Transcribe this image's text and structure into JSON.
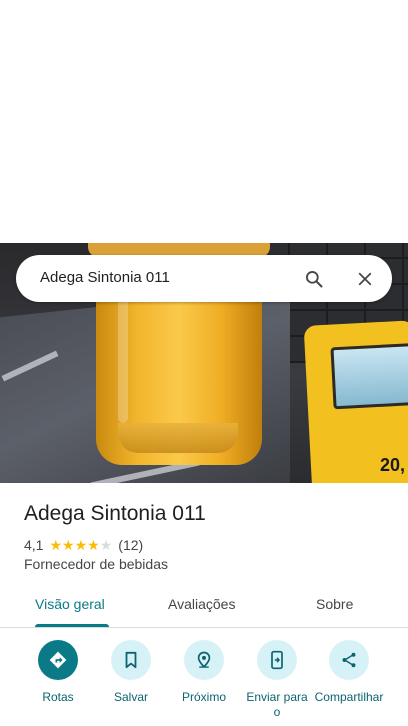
{
  "search": {
    "query": "Adega Sintonia 011"
  },
  "photo": {
    "machine_text": "20,"
  },
  "place": {
    "name": "Adega Sintonia 011",
    "rating": "4,1",
    "rating_value": 4.1,
    "rating_max": 5,
    "review_count": "(12)",
    "category": "Fornecedor de bebidas"
  },
  "tabs": [
    {
      "label": "Visão geral",
      "active": true
    },
    {
      "label": "Avaliações",
      "active": false
    },
    {
      "label": "Sobre",
      "active": false
    }
  ],
  "actions": [
    {
      "label": "Rotas",
      "icon": "directions-icon"
    },
    {
      "label": "Salvar",
      "icon": "bookmark-icon"
    },
    {
      "label": "Próximo",
      "icon": "nearby-icon"
    },
    {
      "label": "Enviar para o",
      "icon": "send-to-phone-icon"
    },
    {
      "label": "Compartilhar",
      "icon": "share-icon"
    }
  ],
  "colors": {
    "accent": "#0b7a87",
    "accent_light": "#d6f2f7",
    "star": "#fbbc04"
  }
}
